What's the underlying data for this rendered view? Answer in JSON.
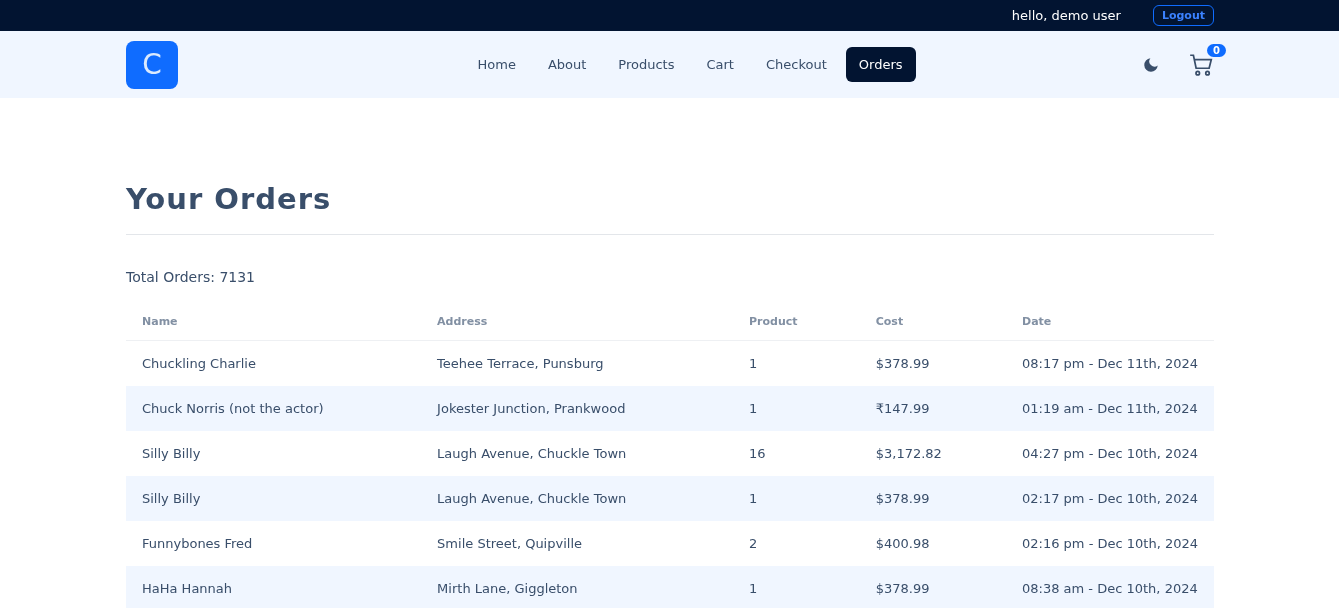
{
  "top_bar": {
    "greeting": "hello, demo user",
    "logout": "Logout"
  },
  "navbar": {
    "logo": "C",
    "links": [
      {
        "label": "Home",
        "selected": false
      },
      {
        "label": "About",
        "selected": false
      },
      {
        "label": "Products",
        "selected": false
      },
      {
        "label": "Cart",
        "selected": false
      },
      {
        "label": "Checkout",
        "selected": false
      },
      {
        "label": "Orders",
        "selected": true
      }
    ],
    "cart_count": "0"
  },
  "page": {
    "title": "Your Orders",
    "total": "Total Orders: 7131"
  },
  "table": {
    "columns": [
      "Name",
      "Address",
      "Product",
      "Cost",
      "Date"
    ],
    "rows": [
      [
        "Chuckling Charlie",
        "Teehee Terrace, Punsburg",
        "1",
        "$378.99",
        "08:17 pm - Dec 11th, 2024"
      ],
      [
        "Chuck Norris (not the actor)",
        "Jokester Junction, Prankwood",
        "1",
        "₹147.99",
        "01:19 am - Dec 11th, 2024"
      ],
      [
        "Silly Billy",
        "Laugh Avenue, Chuckle Town",
        "16",
        "$3,172.82",
        "04:27 pm - Dec 10th, 2024"
      ],
      [
        "Silly Billy",
        "Laugh Avenue, Chuckle Town",
        "1",
        "$378.99",
        "02:17 pm - Dec 10th, 2024"
      ],
      [
        "Funnybones Fred",
        "Smile Street, Quipville",
        "2",
        "$400.98",
        "02:16 pm - Dec 10th, 2024"
      ],
      [
        "HaHa Hannah",
        "Mirth Lane, Giggleton",
        "1",
        "$378.99",
        "08:38 am - Dec 10th, 2024"
      ]
    ]
  }
}
